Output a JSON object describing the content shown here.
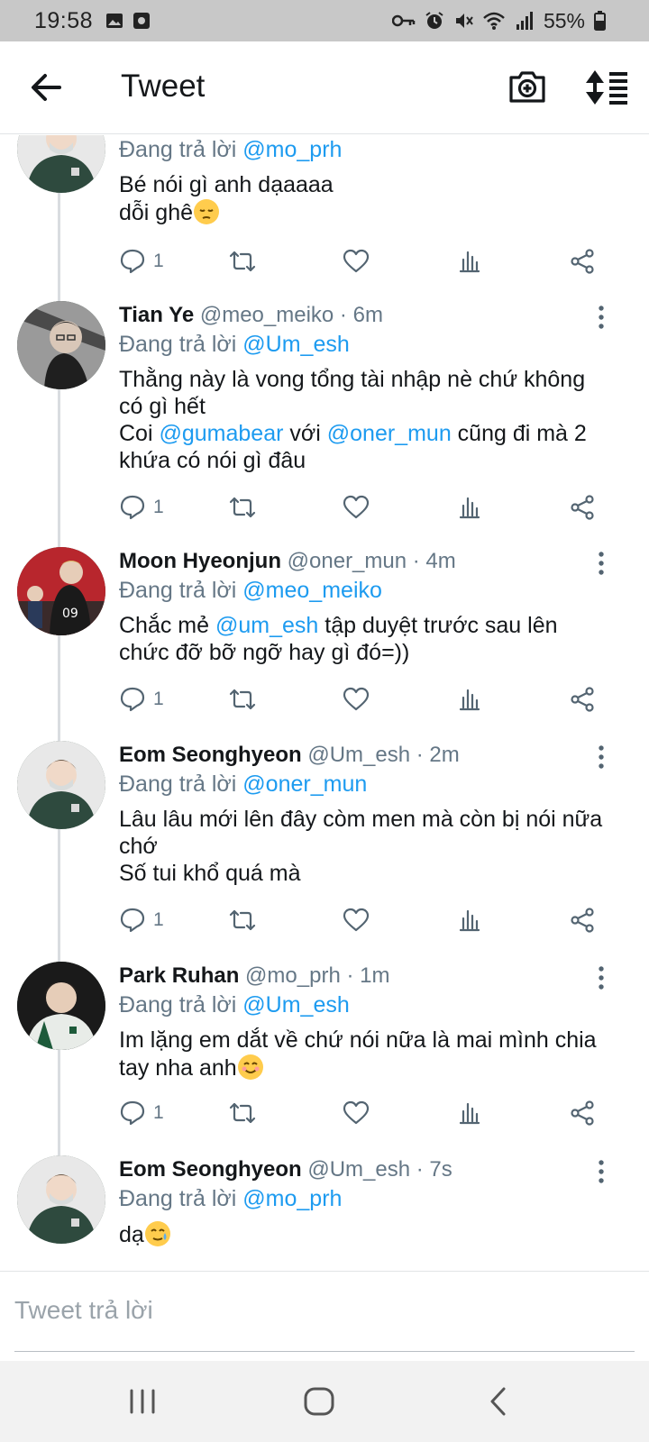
{
  "status_bar": {
    "time": "19:58",
    "battery": "55%",
    "background": "#c8c8c8",
    "left_icons": [
      "gallery-icon",
      "app-notification-icon"
    ],
    "right_icons": [
      "vpn-key-icon",
      "alarm-icon",
      "mute-icon",
      "wifi-icon",
      "signal-icon",
      "battery-icon"
    ]
  },
  "header": {
    "title": "Tweet",
    "icons": [
      "back-arrow-icon",
      "camera-add-icon",
      "sort-icon"
    ]
  },
  "accent_color": "#1d9bf0",
  "tweets": [
    {
      "name": "",
      "handle": "",
      "time": "",
      "reply_prefix": "Đang trả lời",
      "reply_to": "@mo_prh",
      "body_line1": "Bé nói gì anh dạaaaa",
      "body_line2": "dỗi ghê",
      "emoji": "pensive-face-emoji",
      "reply_count": "1"
    },
    {
      "name": "Tian Ye",
      "handle": "@meo_meiko · 6m",
      "reply_prefix": "Đang trả lời",
      "reply_to": "@Um_esh",
      "body_line1": "Thằng này là vong tổng tài nhập nè chứ không",
      "body_line2": "có gì hết",
      "body_line3_a": "Coi ",
      "body_line3_m1": "@gumabear",
      "body_line3_b": " với ",
      "body_line3_m2": "@oner_mun",
      "body_line3_c": " cũng đi mà 2",
      "body_line4": "khứa có nói gì đâu",
      "reply_count": "1"
    },
    {
      "name": "Moon Hyeonjun",
      "handle": "@oner_mun · 4m",
      "reply_prefix": "Đang trả lời",
      "reply_to": "@meo_meiko",
      "body_line1_a": "Chắc mẻ ",
      "body_line1_m": "@um_esh",
      "body_line1_b": " tập duyệt trước sau lên",
      "body_line2": "chức đỡ bỡ ngỡ hay gì đó=))",
      "reply_count": "1"
    },
    {
      "name": "Eom Seonghyeon",
      "handle": "@Um_esh · 2m",
      "reply_prefix": "Đang trả lời",
      "reply_to": "@oner_mun",
      "body_line1": "Lâu lâu mới lên đây còm men mà còn bị nói nữa",
      "body_line2": "chớ",
      "body_line3": "Số tui khổ quá mà",
      "reply_count": "1"
    },
    {
      "name": "Park Ruhan",
      "handle": "@mo_prh · 1m",
      "reply_prefix": "Đang trả lời",
      "reply_to": "@Um_esh",
      "body_line1": "Im lặng em dắt về chứ nói nữa là mai mình chia",
      "body_line2": "tay nha anh",
      "emoji": "smiling-face-emoji",
      "reply_count": "1"
    },
    {
      "name": "Eom Seonghyeon",
      "handle": "@Um_esh · 7s",
      "reply_prefix": "Đang trả lời",
      "reply_to": "@mo_prh",
      "body_line1": "dạ",
      "emoji": "smiling-face-with-tear-emoji"
    }
  ],
  "action_icons": [
    "reply-icon",
    "retweet-icon",
    "like-icon",
    "analytics-icon",
    "share-icon"
  ],
  "reply_bar": {
    "placeholder": "Tweet trả lời"
  },
  "nav_bar": {
    "icons": [
      "recent-apps-icon",
      "home-icon",
      "back-icon"
    ]
  }
}
